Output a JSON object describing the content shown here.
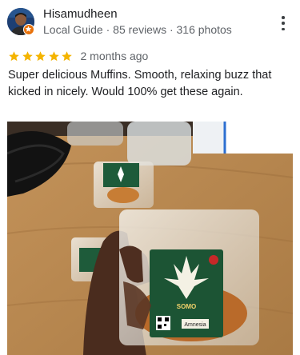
{
  "review": {
    "author": {
      "name": "Hisamudheen",
      "meta": "Local Guide · 85 reviews · 316 photos",
      "avatar": "profile-photo",
      "badge": "local-guide-badge-icon"
    },
    "more_menu": "more-vert-icon",
    "rating": {
      "stars": 5,
      "max": 5,
      "star_color": "#f4b400"
    },
    "date": "2 months ago",
    "text": "Super delicious Muffins. Smooth, relaxing buzz that kicked in nicely. Would 100% get these again.",
    "photo": {
      "content": "hand holding packaged muffins on a wooden table",
      "package_label": "SOMO",
      "package_sticker": "Amnesia"
    }
  },
  "colors": {
    "text_primary": "#202124",
    "text_secondary": "#5f6368",
    "star": "#f4b400",
    "badge": "#e8710a"
  }
}
